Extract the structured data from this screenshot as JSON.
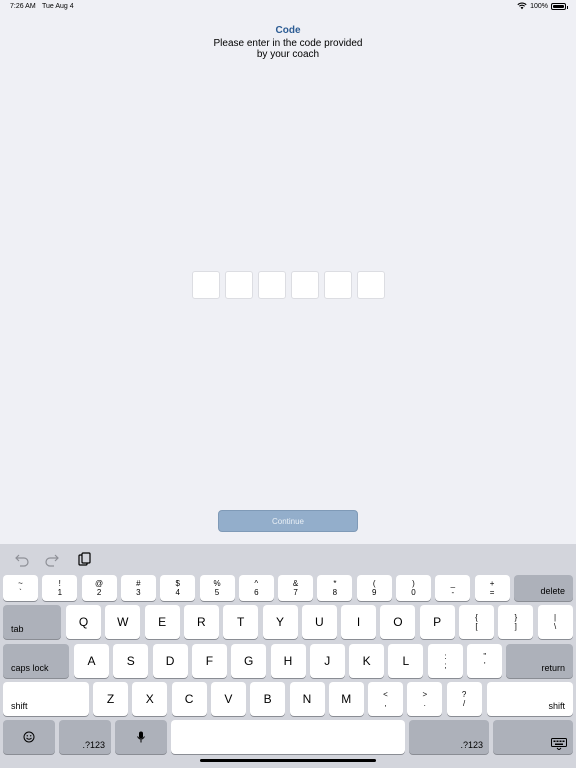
{
  "status": {
    "time": "7:26 AM",
    "date": "Tue Aug 4",
    "battery": "100%",
    "wifi_icon": "wifi-icon",
    "battery_level": 1.0
  },
  "header": {
    "title": "Code",
    "instructions": "Please enter in the code provided by your coach"
  },
  "code_input": {
    "length": 6,
    "values": [
      "",
      "",
      "",
      "",
      "",
      ""
    ]
  },
  "continue_label": "Continue",
  "colors": {
    "accent": "#2b5b93",
    "continue_bg": "#93aecb",
    "background": "#eff0f5",
    "keyboard_bg": "#d3d5dc"
  },
  "keyboard": {
    "shortcuts": [
      "undo-icon",
      "redo-icon",
      "paste-icon"
    ],
    "number_row": [
      {
        "top": "~",
        "bottom": "`"
      },
      {
        "top": "!",
        "bottom": "1"
      },
      {
        "top": "@",
        "bottom": "2"
      },
      {
        "top": "#",
        "bottom": "3"
      },
      {
        "top": "$",
        "bottom": "4"
      },
      {
        "top": "%",
        "bottom": "5"
      },
      {
        "top": "^",
        "bottom": "6"
      },
      {
        "top": "&",
        "bottom": "7"
      },
      {
        "top": "*",
        "bottom": "8"
      },
      {
        "top": "(",
        "bottom": "9"
      },
      {
        "top": ")",
        "bottom": "0"
      },
      {
        "top": "_",
        "bottom": "-"
      },
      {
        "top": "+",
        "bottom": "="
      }
    ],
    "delete": "delete",
    "tab": "tab",
    "row_q": [
      "Q",
      "W",
      "E",
      "R",
      "T",
      "Y",
      "U",
      "I",
      "O",
      "P"
    ],
    "row_q_sym": [
      {
        "top": "{",
        "bottom": "["
      },
      {
        "top": "}",
        "bottom": "]"
      },
      {
        "top": "|",
        "bottom": "\\"
      }
    ],
    "caps_lock": "caps lock",
    "row_a": [
      "A",
      "S",
      "D",
      "F",
      "G",
      "H",
      "J",
      "K",
      "L"
    ],
    "row_a_sym": [
      {
        "top": ":",
        "bottom": ";"
      },
      {
        "top": "\"",
        "bottom": "'"
      }
    ],
    "return": "return",
    "shift": "shift",
    "row_z": [
      "Z",
      "X",
      "C",
      "V",
      "B",
      "N",
      "M"
    ],
    "row_z_sym": [
      {
        "top": "<",
        "bottom": ","
      },
      {
        "top": ">",
        "bottom": "."
      },
      {
        "top": "?",
        "bottom": "/"
      }
    ],
    "numbers_label": ".?123",
    "emoji_icon": "emoji-icon",
    "mic_icon": "microphone-icon",
    "dismiss_icon": "keyboard-dismiss-icon"
  }
}
